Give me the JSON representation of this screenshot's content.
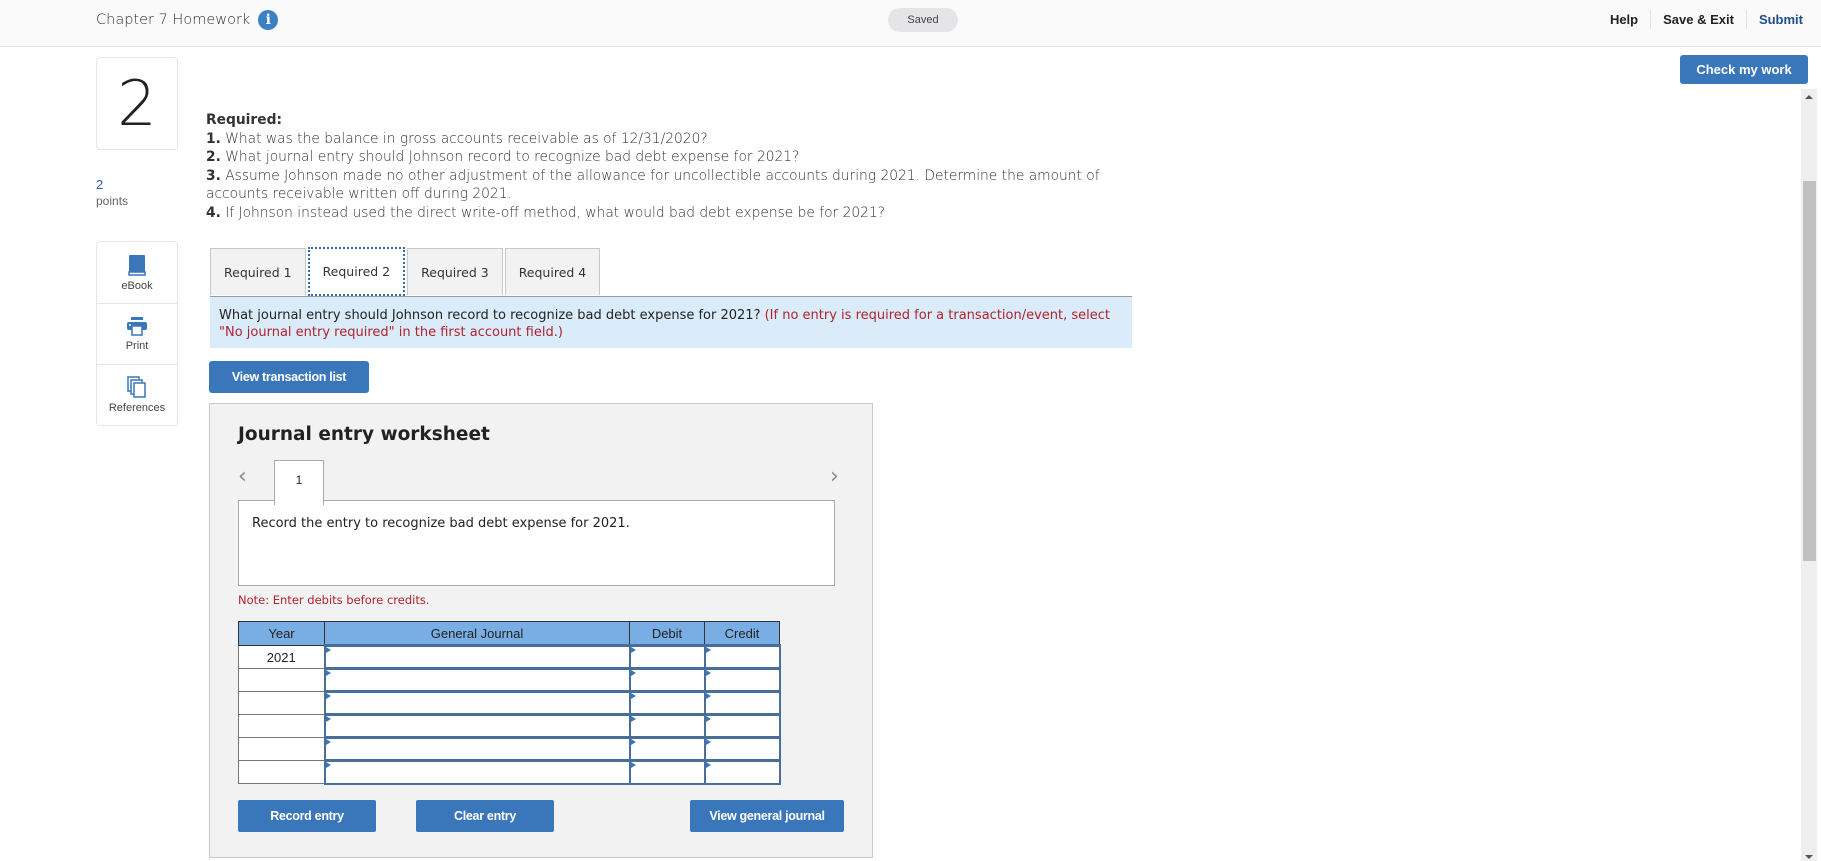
{
  "header": {
    "title": "Chapter 7 Homework",
    "info_icon": "info-icon",
    "status": "Saved",
    "links": {
      "help": "Help",
      "save_exit": "Save & Exit",
      "submit": "Submit"
    },
    "check_work": "Check my work"
  },
  "question": {
    "number": "2",
    "points_value": "2",
    "points_label": "points"
  },
  "tools": [
    {
      "icon": "book-icon",
      "label": "eBook"
    },
    {
      "icon": "printer-icon",
      "label": "Print"
    },
    {
      "icon": "copy-icon",
      "label": "References"
    }
  ],
  "required": {
    "heading": "Required:",
    "items": [
      {
        "num": "1.",
        "text": " What was the balance in gross accounts receivable as of 12/31/2020?"
      },
      {
        "num": "2.",
        "text": " What journal entry should Johnson record to recognize bad debt expense for 2021?"
      },
      {
        "num": "3.",
        "text": " Assume Johnson made no other adjustment of the allowance for uncollectible accounts during 2021. Determine the amount of accounts receivable written off during 2021."
      },
      {
        "num": "4.",
        "text": " If Johnson instead used the direct write-off method, what would bad debt expense be for 2021?"
      }
    ]
  },
  "tabs": [
    {
      "label": "Required 1",
      "active": false
    },
    {
      "label": "Required 2",
      "active": true
    },
    {
      "label": "Required 3",
      "active": false
    },
    {
      "label": "Required 4",
      "active": false
    }
  ],
  "prompt": {
    "text": "What journal entry should Johnson record to recognize bad debt expense for 2021? ",
    "instruction": "(If no entry is required for a transaction/event, select \"No journal entry required\" in the first account field.)"
  },
  "view_transaction_list": "View transaction list",
  "worksheet": {
    "title": "Journal entry worksheet",
    "page": "1",
    "description": "Record the entry to recognize bad debt expense for 2021.",
    "note": "Note: Enter debits before credits.",
    "columns": [
      "Year",
      "General Journal",
      "Debit",
      "Credit"
    ],
    "rows": [
      {
        "year": "2021",
        "account": "",
        "debit": "",
        "credit": ""
      },
      {
        "year": "",
        "account": "",
        "debit": "",
        "credit": ""
      },
      {
        "year": "",
        "account": "",
        "debit": "",
        "credit": ""
      },
      {
        "year": "",
        "account": "",
        "debit": "",
        "credit": ""
      },
      {
        "year": "",
        "account": "",
        "debit": "",
        "credit": ""
      },
      {
        "year": "",
        "account": "",
        "debit": "",
        "credit": ""
      }
    ],
    "buttons": {
      "record": "Record entry",
      "clear": "Clear entry",
      "view_journal": "View general journal"
    }
  },
  "colors": {
    "accent": "#3a76ba",
    "prompt_bg": "#daebf9",
    "table_header": "#79aee4",
    "note_red": "#b2222f"
  }
}
